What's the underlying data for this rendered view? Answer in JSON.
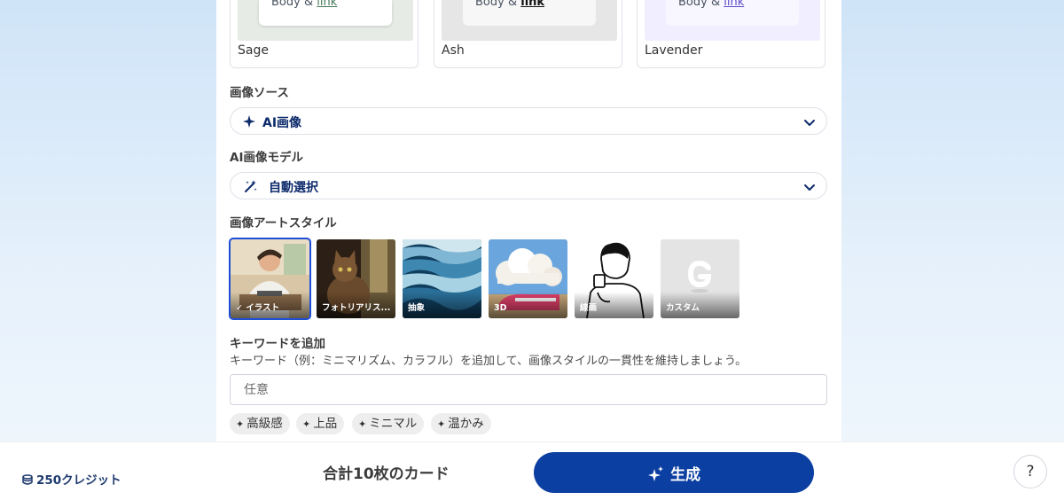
{
  "themes": [
    {
      "name": "Sage",
      "preview_text": "Body & ",
      "preview_link": "link",
      "preview_bg": "#e6ebe6",
      "link_color": "#4a7a57"
    },
    {
      "name": "Ash",
      "preview_text": "Body & ",
      "preview_link": "link",
      "preview_bg": "#e6e6e6",
      "link_color": "#111111"
    },
    {
      "name": "Lavender",
      "preview_text": "Body & ",
      "preview_link": "link",
      "preview_bg": "#f1efff",
      "link_color": "#5a4bc8"
    }
  ],
  "image_source": {
    "label": "画像ソース",
    "value": "AI画像",
    "icon": "sparkle-icon"
  },
  "ai_model": {
    "label": "AI画像モデル",
    "value": "自動選択",
    "icon": "magic-wand-icon"
  },
  "art_style": {
    "label": "画像アートスタイル",
    "selected_index": 0,
    "options": [
      {
        "label": "イラスト",
        "icon": "image-illustration"
      },
      {
        "label": "フォトリアリス...",
        "icon": "image-cat-photo"
      },
      {
        "label": "抽象",
        "icon": "image-abstract-waves"
      },
      {
        "label": "3D",
        "icon": "image-3d-train"
      },
      {
        "label": "線画",
        "icon": "image-line-art"
      },
      {
        "label": "カスタム",
        "icon": "image-custom-g"
      }
    ]
  },
  "keywords": {
    "label": "キーワードを追加",
    "description": "キーワード（例：ミニマリズム、カラフル）を追加して、画像スタイルの一貫性を維持しましょう。",
    "placeholder": "任意",
    "value": "",
    "suggestions": [
      "高級感",
      "上品",
      "ミニマル",
      "温かみ"
    ]
  },
  "footer": {
    "credits": "250クレジット",
    "total": "合計10枚のカード",
    "generate": "生成",
    "help": "?"
  },
  "colors": {
    "primary": "#0b3fa1",
    "selected_outline": "#1d4ed8"
  }
}
